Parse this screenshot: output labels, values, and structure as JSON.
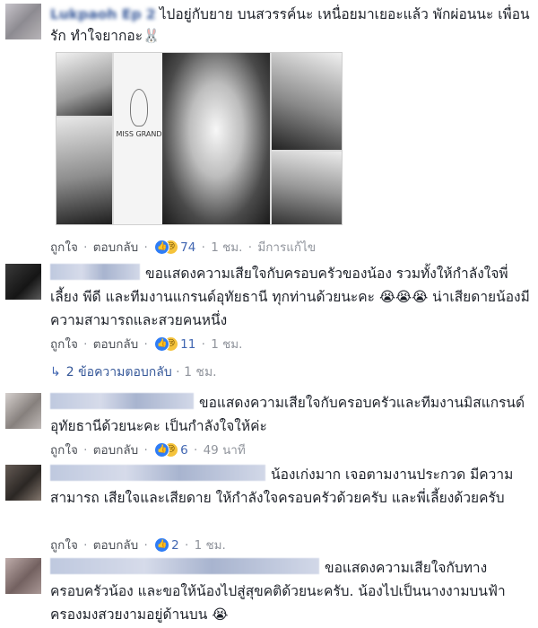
{
  "comments": [
    {
      "name_label": "Lukpaoh Ep 2",
      "text": "ไปอยู่กับยาย บนสวรรค์นะ เหนื่อยมาเยอะแล้ว พักผ่อนนะ เพื่อนรัก ทำใจยากอะ🐰",
      "photo_caption": "MISS GRAND",
      "actions": {
        "like": "ถูกใจ",
        "reply": "ตอบกลับ",
        "count": "74",
        "time": "1 ชม.",
        "edited": "มีการแก้ไข"
      }
    },
    {
      "text": "ขอแสดงความเสียใจกับครอบครัวของน้อง รวมทั้งให้กำลังใจพี่เลี้ยง พีดี และทีมงานแกรนด์อุทัยธานี ทุกท่านด้วยนะคะ 😭😭😭 น่าเสียดายน้องมีความสามารถและสวยคนหนึ่ง",
      "actions": {
        "like": "ถูกใจ",
        "reply": "ตอบกลับ",
        "count": "11",
        "time": "1 ชม."
      },
      "replies": {
        "label": "2 ข้อความตอบกลับ",
        "time": "1 ชม."
      }
    },
    {
      "text": "ขอแสดงความเสียใจกับครอบครัวและทีมงานมิสแกรนด์อุทัยธานีด้วยนะคะ เป็นกำลังใจให้ค่ะ",
      "actions": {
        "like": "ถูกใจ",
        "reply": "ตอบกลับ",
        "count": "6",
        "time": "49 นาที"
      }
    },
    {
      "text": "น้องเก่งมาก เจอตามงานประกวด มีความสามารถ เสียใจและเสียดาย ให้กำลังใจครอบครัวด้วยครับ และพี่เลี้ยงด้วยครับ",
      "actions": {
        "like": "ถูกใจ",
        "reply": "ตอบกลับ",
        "count": "2",
        "time": "1 ชม."
      }
    },
    {
      "text": "ขอแสดงความเสียใจกับทางครอบครัวน้อง และขอให้น้องไปสู่สุขคติด้วยนะครับ. น้องไปเป็นนางงามบนฟ้า ครองมงสวยงามอยู่ด้านบน 😭"
    }
  ],
  "icons": {
    "like": "like-reaction-icon",
    "sad": "sad-reaction-icon",
    "reply_arrow": "reply-arrow-icon"
  },
  "colors": {
    "link": "#365899",
    "meta": "#90949c",
    "like_blue": "#2f7df6",
    "sad_yellow": "#f5c33b"
  }
}
